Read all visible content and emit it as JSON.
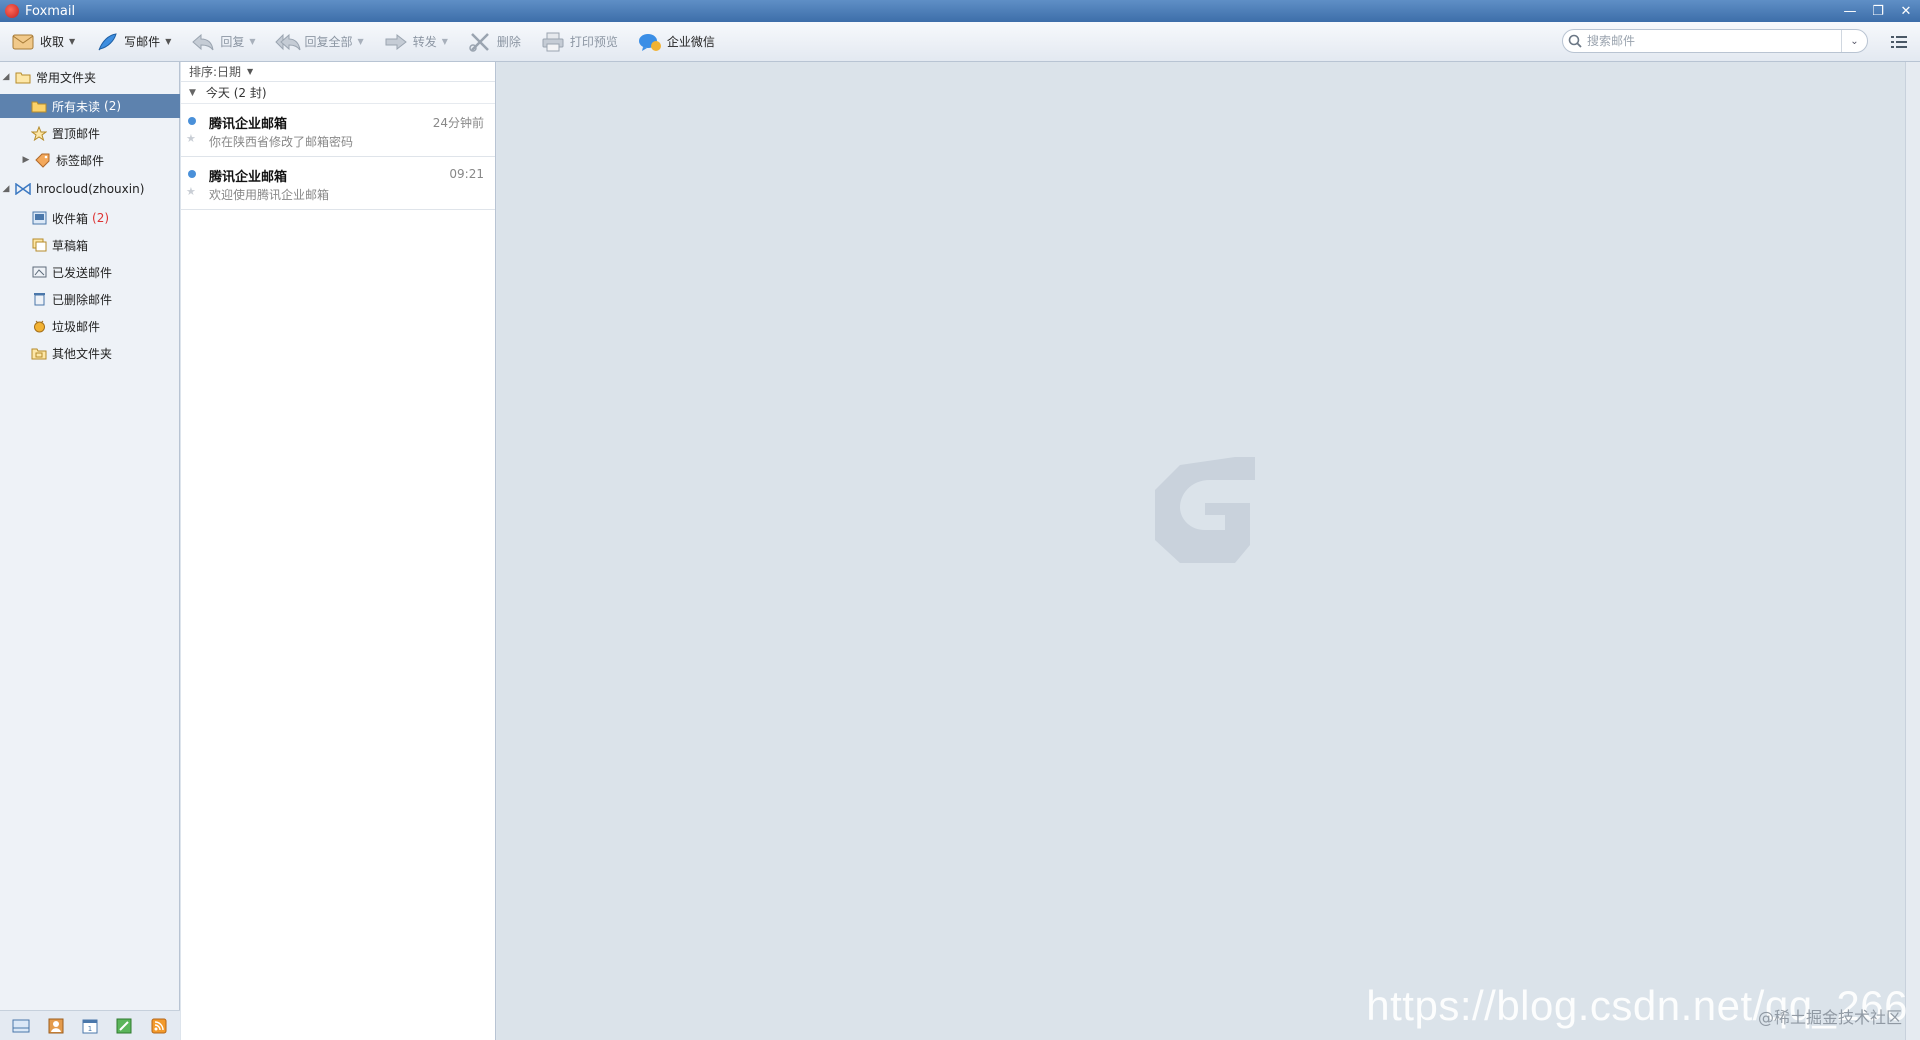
{
  "window": {
    "title": "Foxmail",
    "controls": [
      "—",
      "❐",
      "✕"
    ]
  },
  "toolbar": {
    "receive": "收取",
    "compose": "写邮件",
    "reply": "回复",
    "reply_all": "回复全部",
    "forward": "转发",
    "delete": "删除",
    "print_preview": "打印预览",
    "wecom": "企业微信"
  },
  "search": {
    "placeholder": "搜索邮件"
  },
  "sidebar": {
    "favorites": {
      "label": "常用文件夹",
      "items": [
        {
          "label": "所有未读",
          "count": "(2)"
        },
        {
          "label": "置顶邮件"
        },
        {
          "label": "标签邮件"
        }
      ]
    },
    "account": {
      "label": "hrocloud(zhouxin)",
      "folders": [
        {
          "label": "收件箱",
          "count": "(2)"
        },
        {
          "label": "草稿箱"
        },
        {
          "label": "已发送邮件"
        },
        {
          "label": "已删除邮件"
        },
        {
          "label": "垃圾邮件"
        },
        {
          "label": "其他文件夹"
        }
      ]
    }
  },
  "mail_list": {
    "sort_label": "排序:日期",
    "group_label": "今天 (2 封)",
    "mails": [
      {
        "sender": "腾讯企业邮箱",
        "time": "24分钟前",
        "subject": "你在陕西省修改了邮箱密码"
      },
      {
        "sender": "腾讯企业邮箱",
        "time": "09:21",
        "subject": "欢迎使用腾讯企业邮箱"
      }
    ]
  },
  "watermark": {
    "url": "https://blog.csdn.net/qq_266",
    "sub": "@稀土掘金技术社区"
  },
  "colors": {
    "selected": "#5d82ae",
    "unread_dot": "#4a90d9",
    "count": "#dd3333"
  }
}
